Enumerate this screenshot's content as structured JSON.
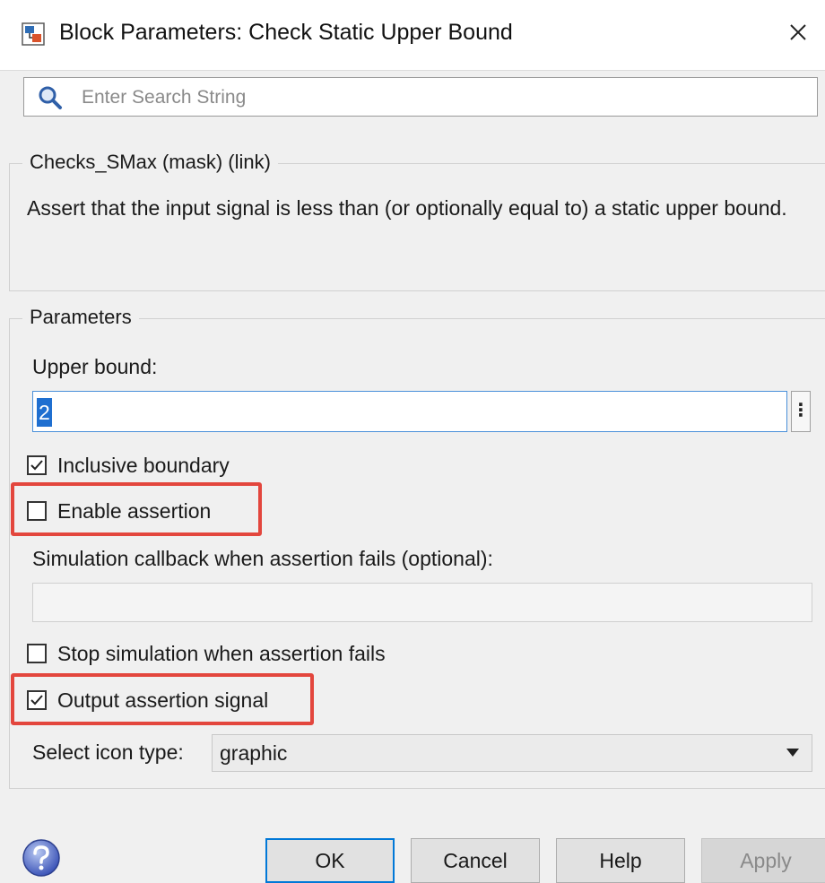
{
  "window": {
    "title": "Block Parameters: Check Static Upper Bound",
    "app_icon": "simulink-block-icon",
    "close_icon": "close-icon"
  },
  "search": {
    "placeholder": "Enter Search String",
    "value": ""
  },
  "description_group": {
    "legend": "Checks_SMax (mask) (link)",
    "text": "Assert that the input signal is less than (or optionally equal to) a static upper bound."
  },
  "parameters": {
    "legend": "Parameters",
    "upper_bound_label": "Upper bound:",
    "upper_bound_value": "2",
    "more_button_label": "⋮",
    "inclusive_boundary": {
      "label": "Inclusive boundary",
      "checked": true
    },
    "enable_assertion": {
      "label": "Enable assertion",
      "checked": false
    },
    "callback_label": "Simulation callback when assertion fails (optional):",
    "callback_value": "",
    "stop_simulation": {
      "label": "Stop simulation when assertion fails",
      "checked": false
    },
    "output_assertion_signal": {
      "label": "Output assertion signal",
      "checked": true
    },
    "icon_type_label": "Select icon type:",
    "icon_type_value": "graphic"
  },
  "buttons": {
    "ok": "OK",
    "cancel": "Cancel",
    "help": "Help",
    "apply": "Apply"
  },
  "colors": {
    "highlight": "#e3463d",
    "accent": "#0078d7",
    "selection": "#1f6fd0"
  }
}
